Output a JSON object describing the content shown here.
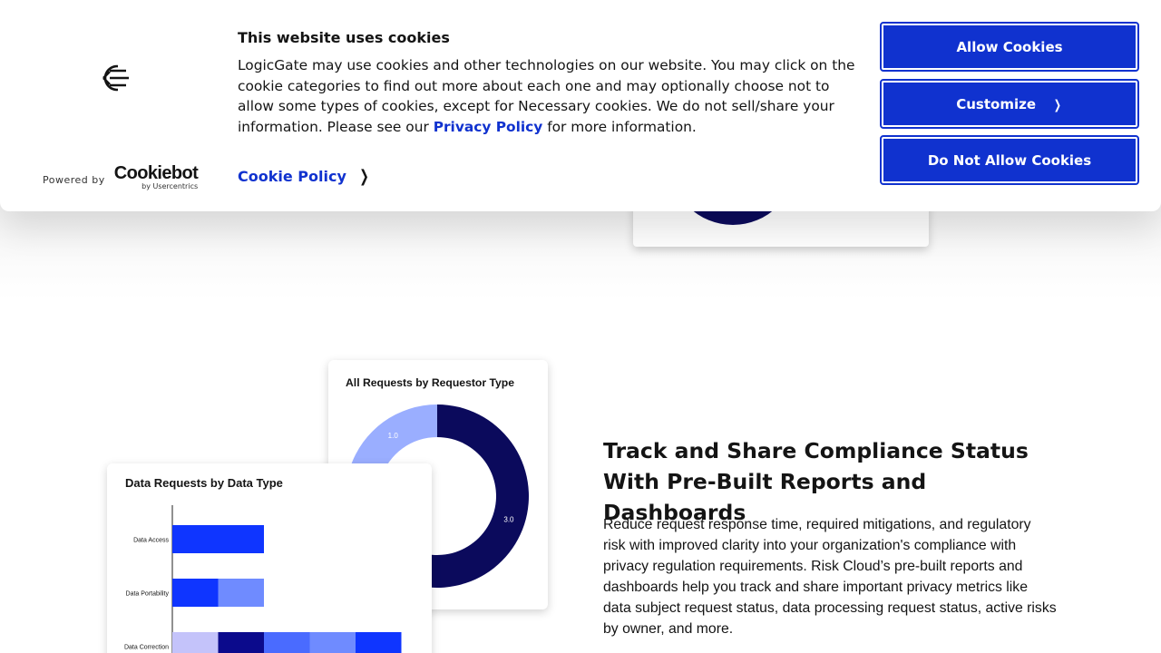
{
  "cookie_banner": {
    "title": "This website uses cookies",
    "text_before_link": "LogicGate may use cookies and other technologies on our website. You may click on the cookie categories to find out more about each one and may optionally choose not to allow some types of cookies, except for Necessary cookies.  We do not sell/share your information. Please see our ",
    "privacy_link": "Privacy Policy",
    "text_after_link": " for more information.",
    "cookie_policy_link": "Cookie Policy",
    "powered_by": "Powered by",
    "cookiebot_word": "Cookiebot",
    "cookiebot_sub": "by Usercentrics",
    "buttons": {
      "allow": "Allow Cookies",
      "customize": "Customize",
      "deny": "Do Not Allow Cookies"
    },
    "icons": {
      "logo": "logicgate-logo-icon",
      "chevron": "chevron-right-icon"
    }
  },
  "section": {
    "title": "Track and Share Compliance Status With Pre-Built Reports and Dashboards",
    "body": "Reduce request response time, required mitigations, and regulatory risk with improved clarity into your organization's compliance with privacy regulation requirements. Risk Cloud’s pre-built reports and dashboards help you track and share important privacy metrics like data subject request status, data processing request status, active risks by owner, and more."
  },
  "colors": {
    "accent": "#1032cf",
    "navy": "#0b0a5c",
    "blue": "#0f35ff",
    "mid_blue": "#4a6bff",
    "light_blue": "#8fa6ff",
    "lavender": "#c4c3fa"
  },
  "chart_data": [
    {
      "type": "pie",
      "title": "All Requests by Requestor Type",
      "values": [
        3.0,
        1.0,
        1.0
      ],
      "labels": [
        "3.0",
        "1.0",
        "1.0"
      ],
      "colors": [
        "#0b0a5c",
        "#0f2fd0",
        "#9aaeff"
      ]
    },
    {
      "type": "bar",
      "title": "Data Requests by Data Type",
      "categories": [
        "Data Access",
        "Data Portability",
        "Data Correction"
      ],
      "series": [
        {
          "values": [
            2,
            1,
            1
          ],
          "color": "#0f35ff"
        },
        {
          "values": [
            0,
            1,
            1
          ],
          "color": "#6f8bff"
        },
        {
          "values": [
            0,
            0,
            1
          ],
          "color": "#c4c3fa"
        },
        {
          "values": [
            0,
            0,
            1
          ],
          "color": "#0b0a8c"
        }
      ]
    }
  ]
}
